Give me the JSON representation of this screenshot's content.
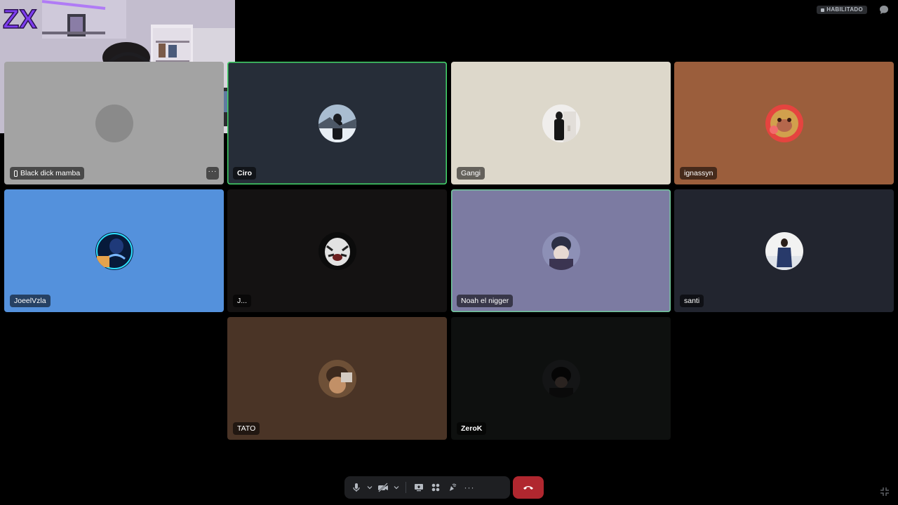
{
  "top_bar": {
    "status_badge": "HABILITADO"
  },
  "participants": [
    {
      "id": "black-dick-mamba",
      "name": "Black dick mamba",
      "on_mobile": true,
      "bg": "#a3a3a3",
      "bold": false
    },
    {
      "id": "ciro",
      "name": "Ciro",
      "bg": "#262d38",
      "speaking": true,
      "bold": true
    },
    {
      "id": "gangi",
      "name": "Gangi",
      "bg": "#ddd8cb",
      "bold": false
    },
    {
      "id": "ignassyn",
      "name": "ignassyn",
      "bg": "#9b5e3c",
      "bold": false
    },
    {
      "id": "joeelvzla",
      "name": "JoeelVzla",
      "bg": "#5491dc",
      "bold": false
    },
    {
      "id": "j",
      "name": "J...",
      "bg": "#141212",
      "bold": false
    },
    {
      "id": "noah",
      "name": "Noah el nigger",
      "bg": "#7c7ba2",
      "speaking": true,
      "bold": false
    },
    {
      "id": "santi",
      "name": "santi",
      "bg": "#22252f",
      "bold": false
    },
    {
      "id": "tato",
      "name": "TATO",
      "bg": "#4a3426",
      "bold": false
    },
    {
      "id": "zerok",
      "name": "ZeroK",
      "bg": "#0e100f",
      "bold": true
    }
  ],
  "tile_more_label": "···",
  "controls": {
    "icons": [
      "microphone-icon",
      "chevron-down-icon",
      "camera-off-icon",
      "chevron-down-icon",
      "screen-share-icon",
      "activities-icon",
      "soundboard-icon",
      "more-icon",
      "disconnect-icon"
    ],
    "more_label": "···"
  },
  "webcam_overlay": {
    "logo": "ZX"
  }
}
